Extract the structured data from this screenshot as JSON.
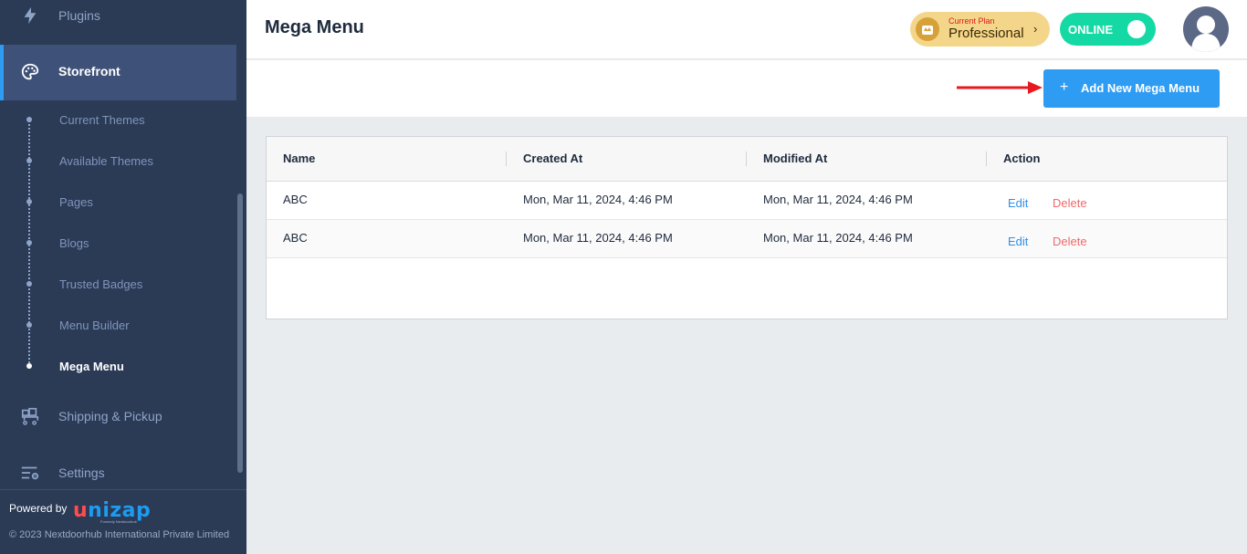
{
  "sidebar": {
    "top_item": {
      "label": "Plugins",
      "icon": "lightning-icon"
    },
    "active_item": {
      "label": "Storefront",
      "icon": "palette-icon"
    },
    "sub_items": [
      {
        "label": "Current Themes"
      },
      {
        "label": "Available Themes"
      },
      {
        "label": "Pages"
      },
      {
        "label": "Blogs"
      },
      {
        "label": "Trusted Badges"
      },
      {
        "label": "Menu Builder"
      },
      {
        "label": "Mega Menu",
        "active": true
      }
    ],
    "items": [
      {
        "label": "Shipping & Pickup",
        "icon": "delivery-cart-icon"
      },
      {
        "label": "Settings",
        "icon": "settings-sliders-icon"
      }
    ],
    "footer": {
      "powered_by": "Powered by",
      "logo_text": "unizap",
      "logo_u": "u",
      "logo_rest": "nizap",
      "logo_sub": "Formerly Nextdoorhub",
      "copyright": "© 2023 Nextdoorhub International Private Limited"
    }
  },
  "header": {
    "title": "Mega Menu",
    "plan": {
      "label": "Current Plan",
      "name": "Professional",
      "chevron": "›"
    },
    "status": {
      "label": "ONLINE",
      "on": true
    }
  },
  "actions": {
    "add_button": {
      "plus": "+",
      "label": "Add New Mega Menu"
    }
  },
  "table": {
    "columns": [
      "Name",
      "Created At",
      "Modified At",
      "Action"
    ],
    "rows": [
      {
        "name": "ABC",
        "created_at": "Mon, Mar 11, 2024, 4:46 PM",
        "modified_at": "Mon, Mar 11, 2024, 4:46 PM",
        "edit": "Edit",
        "delete": "Delete"
      },
      {
        "name": "ABC",
        "created_at": "Mon, Mar 11, 2024, 4:46 PM",
        "modified_at": "Mon, Mar 11, 2024, 4:46 PM",
        "edit": "Edit",
        "delete": "Delete"
      }
    ]
  },
  "colors": {
    "sidebar_bg": "#2b3a55",
    "sidebar_active_bg": "#3e5279",
    "accent_blue": "#2f9cf3",
    "online_green": "#14d9a4",
    "plan_gold": "#f4d68a",
    "delete_red": "#ef6a6a",
    "arrow_red": "#e8191e"
  }
}
